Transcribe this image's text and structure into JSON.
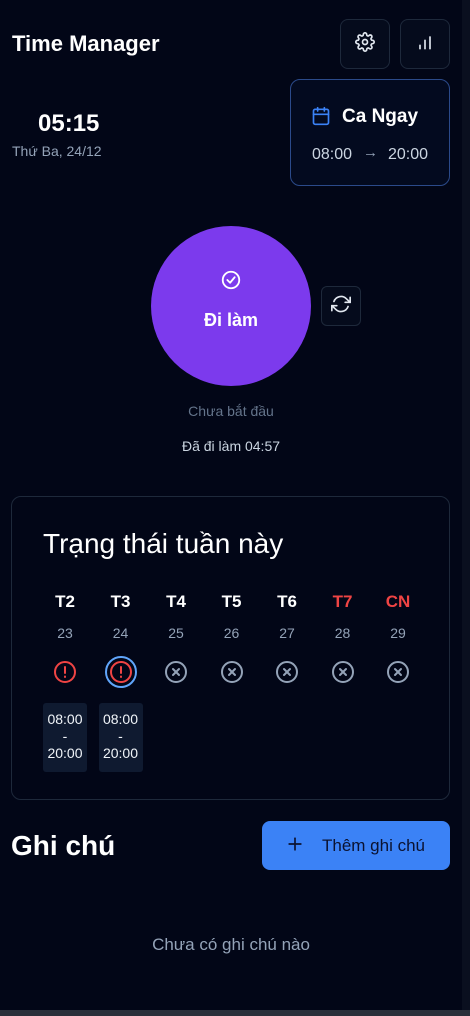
{
  "header": {
    "title": "Time Manager",
    "settings_icon": "gear-icon",
    "stats_icon": "bar-chart-icon"
  },
  "clock": {
    "time": "05:15",
    "date": "Thứ Ba, 24/12"
  },
  "shift": {
    "name": "Ca Ngay",
    "start": "08:00",
    "arrow": "→",
    "end": "20:00",
    "icon": "calendar-icon",
    "accent": "#3b82f6"
  },
  "action": {
    "label": "Đi làm",
    "icon": "check-circle-icon",
    "refresh_icon": "refresh-icon",
    "color": "#7c3aed",
    "status": "Chưa bắt đầu",
    "worked": "Đã đi làm 04:57"
  },
  "week": {
    "title": "Trạng thái tuần này",
    "days": [
      {
        "label": "T2",
        "date": "23",
        "status": "warning",
        "hours": [
          "08:00",
          "-",
          "20:00"
        ],
        "weekend": false,
        "selected": false
      },
      {
        "label": "T3",
        "date": "24",
        "status": "warning",
        "hours": [
          "08:00",
          "-",
          "20:00"
        ],
        "weekend": false,
        "selected": true
      },
      {
        "label": "T4",
        "date": "25",
        "status": "absent",
        "hours": null,
        "weekend": false,
        "selected": false
      },
      {
        "label": "T5",
        "date": "26",
        "status": "absent",
        "hours": null,
        "weekend": false,
        "selected": false
      },
      {
        "label": "T6",
        "date": "27",
        "status": "absent",
        "hours": null,
        "weekend": false,
        "selected": false
      },
      {
        "label": "T7",
        "date": "28",
        "status": "absent",
        "hours": null,
        "weekend": true,
        "selected": false
      },
      {
        "label": "CN",
        "date": "29",
        "status": "absent",
        "hours": null,
        "weekend": true,
        "selected": false
      }
    ],
    "colors": {
      "warning": "#ef4444",
      "absent": "#94a3b8",
      "weekend": "#ef4444",
      "selected_ring": "#60a5fa"
    }
  },
  "notes": {
    "title": "Ghi chú",
    "add_label": "Thêm ghi chú",
    "add_icon": "plus-icon",
    "empty": "Chưa có ghi chú nào",
    "button_color": "#3b82f6"
  }
}
